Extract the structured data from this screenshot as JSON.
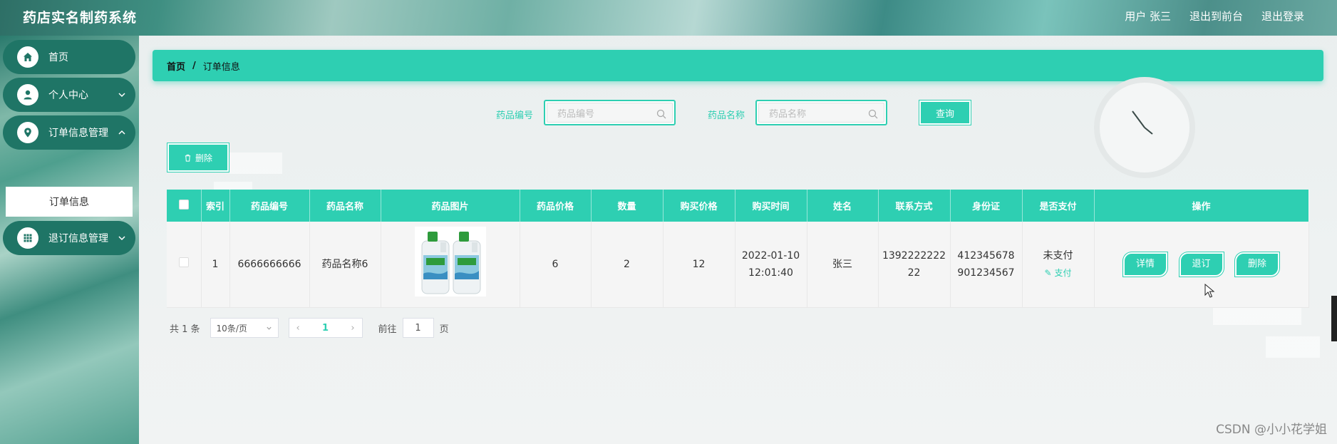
{
  "header": {
    "app_title": "药店实名制药系统",
    "user": "用户 张三",
    "back_front": "退出到前台",
    "logout": "退出登录"
  },
  "sidebar": {
    "items": [
      {
        "label": "首页",
        "icon": "home-icon"
      },
      {
        "label": "个人中心",
        "icon": "user-icon"
      },
      {
        "label": "订单信息管理",
        "icon": "location-icon"
      },
      {
        "label": "退订信息管理",
        "icon": "grid-icon"
      }
    ],
    "sub_item": "订单信息"
  },
  "breadcrumb": {
    "home": "首页",
    "separator": "/",
    "current": "订单信息"
  },
  "search": {
    "code_label": "药品编号",
    "code_placeholder": "药品编号",
    "name_label": "药品名称",
    "name_placeholder": "药品名称",
    "query_button": "查询"
  },
  "toolbar": {
    "delete_button": "删除"
  },
  "table": {
    "headers": [
      "索引",
      "药品编号",
      "药品名称",
      "药品图片",
      "药品价格",
      "数量",
      "购买价格",
      "购买时间",
      "姓名",
      "联系方式",
      "身份证",
      "是否支付",
      "操作"
    ],
    "rows": [
      {
        "index": "1",
        "code": "6666666666",
        "name": "药品名称6",
        "image": "detergent-bottles-image",
        "price": "6",
        "quantity": "2",
        "total": "12",
        "time_date": "2022-01-10",
        "time_clock": "12:01:40",
        "person": "张三",
        "phone_1": "1392222222",
        "phone_2": "22",
        "id_1": "412345678",
        "id_2": "901234567",
        "paid_status": "未支付",
        "pay_link": "支付",
        "actions": [
          "详情",
          "退订",
          "删除"
        ]
      }
    ]
  },
  "pagination": {
    "total": "共 1 条",
    "page_size": "10条/页",
    "current_page": "1",
    "goto_label": "前往",
    "goto_value": "1",
    "page_unit": "页"
  },
  "watermark": "CSDN @小小花学姐",
  "colors": {
    "accent": "#2ecfb2",
    "sidebar_item": "#1f7566"
  }
}
